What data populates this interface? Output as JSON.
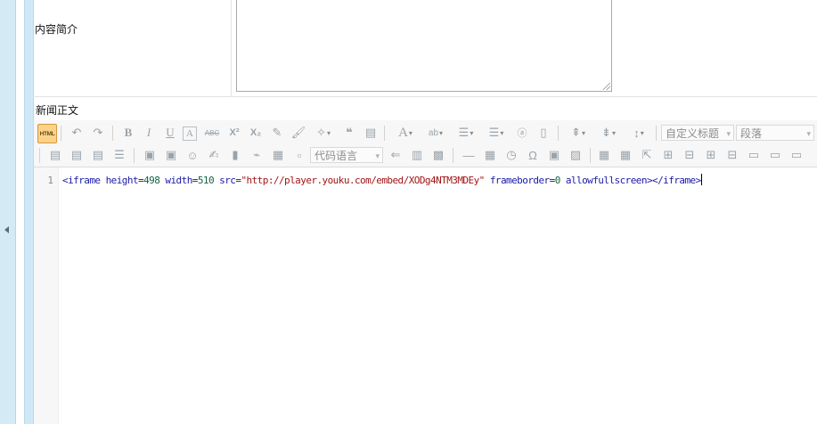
{
  "form": {
    "intro_label": "内容简介",
    "intro_value": "",
    "news_body_label": "新闻正文"
  },
  "editor": {
    "toolbar": {
      "html_button": "HTML",
      "custom_heading": "自定义标题",
      "paragraph": "段落",
      "code_language": "代码语言",
      "bold": "B",
      "italic": "I",
      "underline": "U",
      "font_border": "A",
      "strikethrough": "ABC",
      "superscript": "X²",
      "subscript": "X₂",
      "blockquote": "❝",
      "font_color": "A",
      "highlight": "ab",
      "omega": "Ω"
    },
    "code": {
      "line_number": "1",
      "tag_open": "<iframe",
      "attr_height": "height",
      "val_height": "498",
      "attr_width": "width",
      "val_width": "510",
      "attr_src": "src",
      "val_src": "\"http://player.youku.com/embed/XODg4NTM3MDEy\"",
      "attr_frameborder": "frameborder",
      "val_frameborder": "0",
      "attr_allow": "allowfullscreen",
      "tag_close": "></iframe>"
    }
  },
  "colors": {
    "side_strip": "#d4eaf4",
    "frame_strip": "#cfe8f6",
    "html_button": "#fbd28a",
    "code_tag": "#1a1aa6",
    "code_string": "#a31515",
    "code_number": "#116644"
  }
}
